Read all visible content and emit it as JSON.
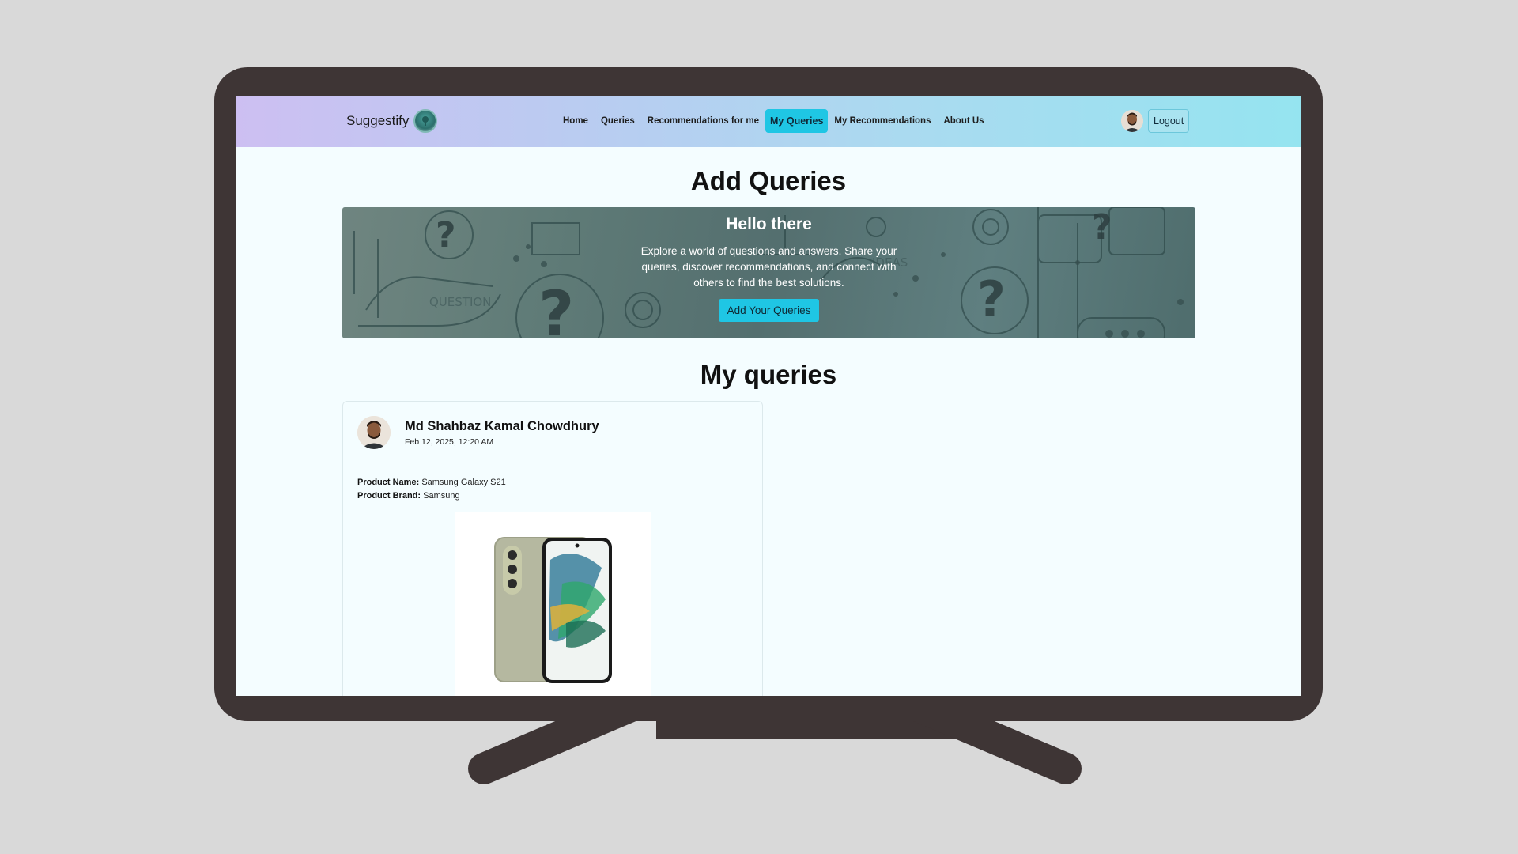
{
  "navbar": {
    "brand": "Suggestify",
    "links": [
      "Home",
      "Queries",
      "Recommendations for me",
      "My Queries",
      "My Recommendations",
      "About Us"
    ],
    "active": "My Queries",
    "logout": "Logout"
  },
  "page": {
    "add_title": "Add Queries",
    "my_title": "My queries"
  },
  "hero": {
    "title": "Hello there",
    "text": "Explore a world of questions and answers. Share your queries, discover recommendations, and connect with others to find the best solutions.",
    "button": "Add Your Queries"
  },
  "query": {
    "author": "Md Shahbaz Kamal Chowdhury",
    "date": "Feb 12, 2025, 12:20 AM",
    "product_name_label": "Product Name:",
    "product_name": "Samsung Galaxy S21",
    "product_brand_label": "Product Brand:",
    "product_brand": "Samsung"
  },
  "icons": {
    "brand_logo": "brand-logo-icon",
    "avatar": "user-avatar",
    "product_image": "phone-image"
  }
}
